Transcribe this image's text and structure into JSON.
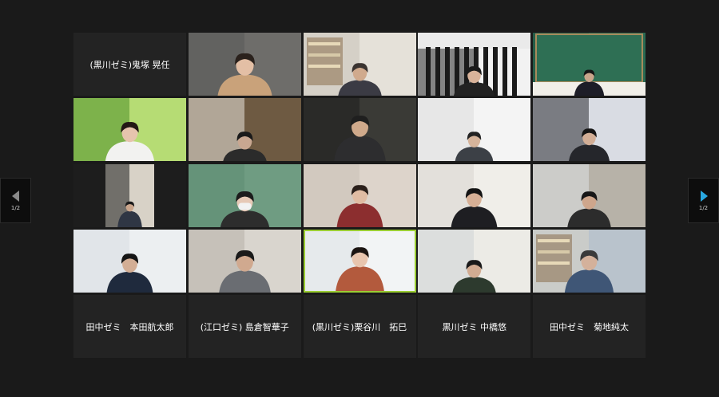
{
  "colors": {
    "background": "#1a1a1a",
    "tile_background": "#232323",
    "active_speaker_border": "#9acd32",
    "next_arrow": "#29a8e0",
    "prev_arrow": "#8a8a8a"
  },
  "pagination": {
    "prev_page_label": "1/2",
    "next_page_label": "1/2"
  },
  "participants": [
    {
      "name": "(黒川ゼミ)鬼塚 晃任",
      "video": false
    },
    {
      "name": "",
      "video": true,
      "scene": "woman-yellow-top-grey-wall"
    },
    {
      "name": "",
      "video": true,
      "scene": "man-bookshelf"
    },
    {
      "name": "",
      "video": true,
      "scene": "boy-grey-curtain"
    },
    {
      "name": "",
      "video": true,
      "scene": "man-blackboard"
    },
    {
      "name": "",
      "video": true,
      "scene": "girl-green-grass-bg"
    },
    {
      "name": "",
      "video": true,
      "scene": "person-dark-room"
    },
    {
      "name": "",
      "video": true,
      "scene": "man-glasses-dark"
    },
    {
      "name": "",
      "video": true,
      "scene": "boy-glasses-white-room"
    },
    {
      "name": "",
      "video": true,
      "scene": "boy-dark-chair"
    },
    {
      "name": "",
      "video": true,
      "scene": "boy-small-window"
    },
    {
      "name": "",
      "video": true,
      "scene": "girl-mask-green-wall"
    },
    {
      "name": "",
      "video": true,
      "scene": "girl-red-top"
    },
    {
      "name": "",
      "video": true,
      "scene": "boy-black-chair"
    },
    {
      "name": "",
      "video": true,
      "scene": "boy-room-corner"
    },
    {
      "name": "",
      "video": true,
      "scene": "boy-navy-top"
    },
    {
      "name": "",
      "video": true,
      "scene": "boy-grey-hoodie"
    },
    {
      "name": "",
      "video": true,
      "scene": "girl-talking-active",
      "active": true
    },
    {
      "name": "",
      "video": true,
      "scene": "boy-sloped-ceiling"
    },
    {
      "name": "",
      "video": true,
      "scene": "man-library"
    },
    {
      "name": "田中ゼミ　本田航太郎",
      "video": false
    },
    {
      "name": "(江口ゼミ) 島倉智華子",
      "video": false
    },
    {
      "name": "(黒川ゼミ)栗谷川　拓巳",
      "video": false
    },
    {
      "name": "黒川ゼミ 中橋悠",
      "video": false
    },
    {
      "name": "田中ゼミ　菊地純太",
      "video": false
    }
  ]
}
